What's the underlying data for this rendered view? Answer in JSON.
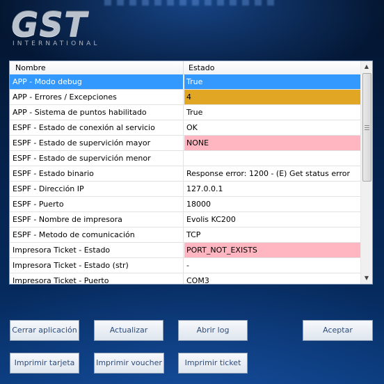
{
  "logo": {
    "brand": "GST",
    "sub": "INTERNATIONAL"
  },
  "grid": {
    "columns": [
      "Nombre",
      "Estado"
    ],
    "rows": [
      {
        "name": "APP - Modo debug",
        "value": "True",
        "highlight": "selected"
      },
      {
        "name": "APP - Errores / Excepciones",
        "value": "4",
        "highlight": "orange"
      },
      {
        "name": "APP - Sistema de puntos habilitado",
        "value": "True",
        "highlight": ""
      },
      {
        "name": "ESPF - Estado de conexión al servicio",
        "value": "OK",
        "highlight": ""
      },
      {
        "name": "ESPF - Estado de supervición mayor",
        "value": "NONE",
        "highlight": "pink"
      },
      {
        "name": "ESPF - Estado de supervición menor",
        "value": "",
        "highlight": ""
      },
      {
        "name": "ESPF - Estado binario",
        "value": "Response error: 1200 - (E) Get status error",
        "highlight": ""
      },
      {
        "name": "ESPF - Dirección IP",
        "value": "127.0.0.1",
        "highlight": ""
      },
      {
        "name": "ESPF - Puerto",
        "value": "18000",
        "highlight": ""
      },
      {
        "name": "ESPF - Nombre de impresora",
        "value": "Evolis KC200",
        "highlight": ""
      },
      {
        "name": "ESPF - Metodo de comunicación",
        "value": "TCP",
        "highlight": ""
      },
      {
        "name": "Impresora Ticket - Estado",
        "value": "PORT_NOT_EXISTS",
        "highlight": "pink"
      },
      {
        "name": "Impresora Ticket - Estado (str)",
        "value": "-",
        "highlight": ""
      },
      {
        "name": "Impresora Ticket - Puerto",
        "value": "COM3",
        "highlight": ""
      }
    ]
  },
  "buttons": {
    "close": "Cerrar aplicación",
    "refresh": "Actualizar",
    "open_log": "Abrir log",
    "accept": "Aceptar",
    "print_card": "Imprimir tarjeta",
    "print_voucher": "Imprimir voucher",
    "print_ticket": "Imprimir ticket"
  },
  "colors": {
    "selected": "#3399ff",
    "orange": "#e0a624",
    "pink": "#ffb6c1",
    "button_text": "#2c4b78"
  }
}
